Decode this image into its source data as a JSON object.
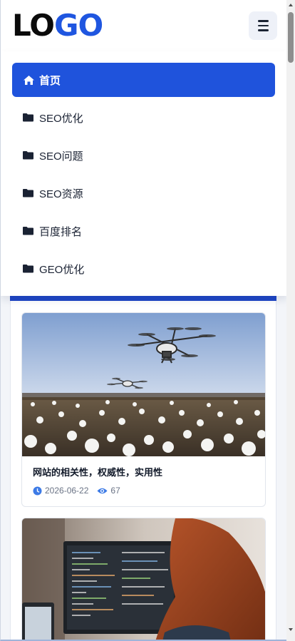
{
  "header": {
    "logo_part1": "LO",
    "logo_part2": "GO",
    "menu_icon": "hamburger-icon"
  },
  "nav": {
    "items": [
      {
        "label": "首页",
        "icon": "home-icon",
        "active": true
      },
      {
        "label": "SEO优化",
        "icon": "folder-icon",
        "active": false
      },
      {
        "label": "SEO问题",
        "icon": "folder-icon",
        "active": false
      },
      {
        "label": "SEO资源",
        "icon": "folder-icon",
        "active": false
      },
      {
        "label": "百度排名",
        "icon": "folder-icon",
        "active": false
      },
      {
        "label": "GEO优化",
        "icon": "folder-icon",
        "active": false
      }
    ]
  },
  "articles": [
    {
      "title": "网站的相关性，权威性，实用性",
      "date": "2026-06-22",
      "views": "67",
      "image": "drones-over-cotton-field"
    },
    {
      "title": "",
      "image": "person-at-code-monitor"
    }
  ],
  "colors": {
    "accent": "#1f53dc",
    "logo_blue": "#1f56e0",
    "text": "#1a2233"
  }
}
